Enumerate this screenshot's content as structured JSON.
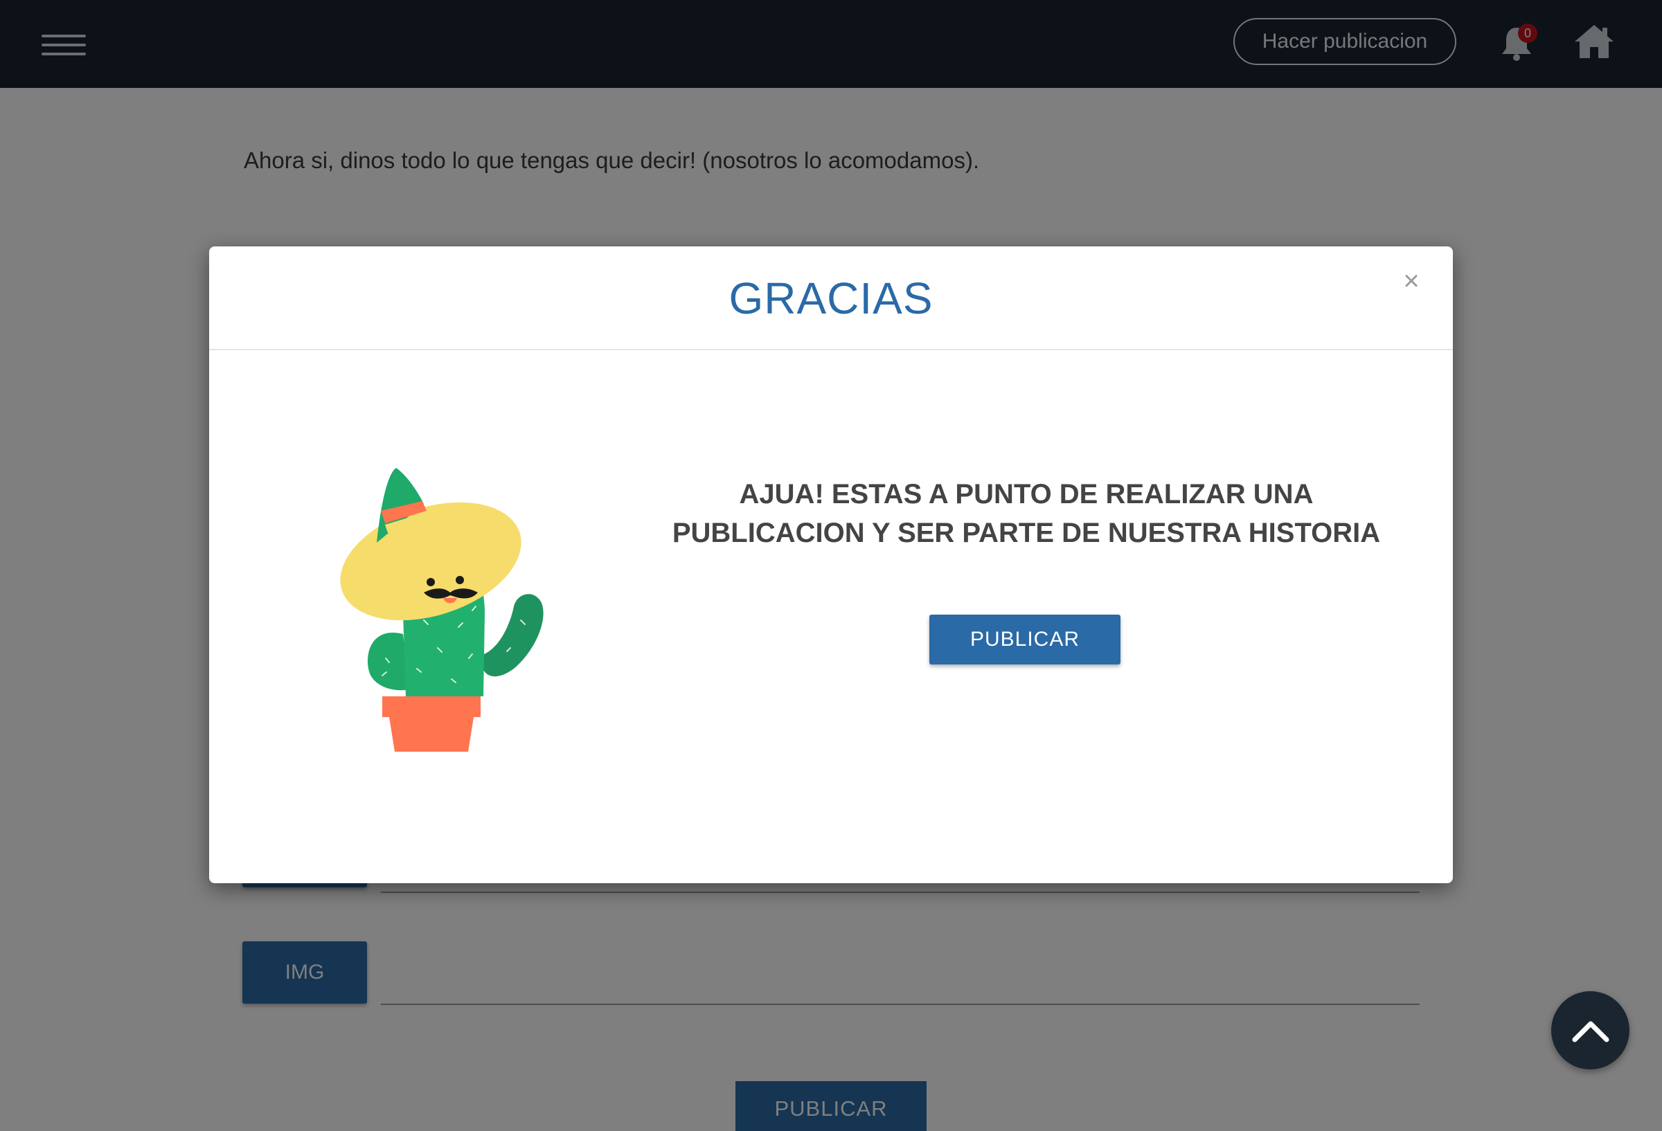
{
  "navbar": {
    "post_button_label": "Hacer publicacion",
    "notification_count": "0"
  },
  "page": {
    "intro_text": "Ahora si, dinos todo lo que tengas que decir! (nosotros lo acomodamos).",
    "img_button_label": "IMG",
    "publish_button_label": "PUBLICAR"
  },
  "modal": {
    "title": "GRACIAS",
    "close_symbol": "×",
    "message_line1": "AJUA! ESTAS A PUNTO DE REALIZAR UNA",
    "message_line2": "PUBLICACION Y SER PARTE DE NUESTRA HISTORIA",
    "publish_button_label": "PUBLICAR"
  },
  "colors": {
    "navbar": "#1a2530",
    "accent": "#2a6aa6",
    "badge": "#c0141c"
  }
}
